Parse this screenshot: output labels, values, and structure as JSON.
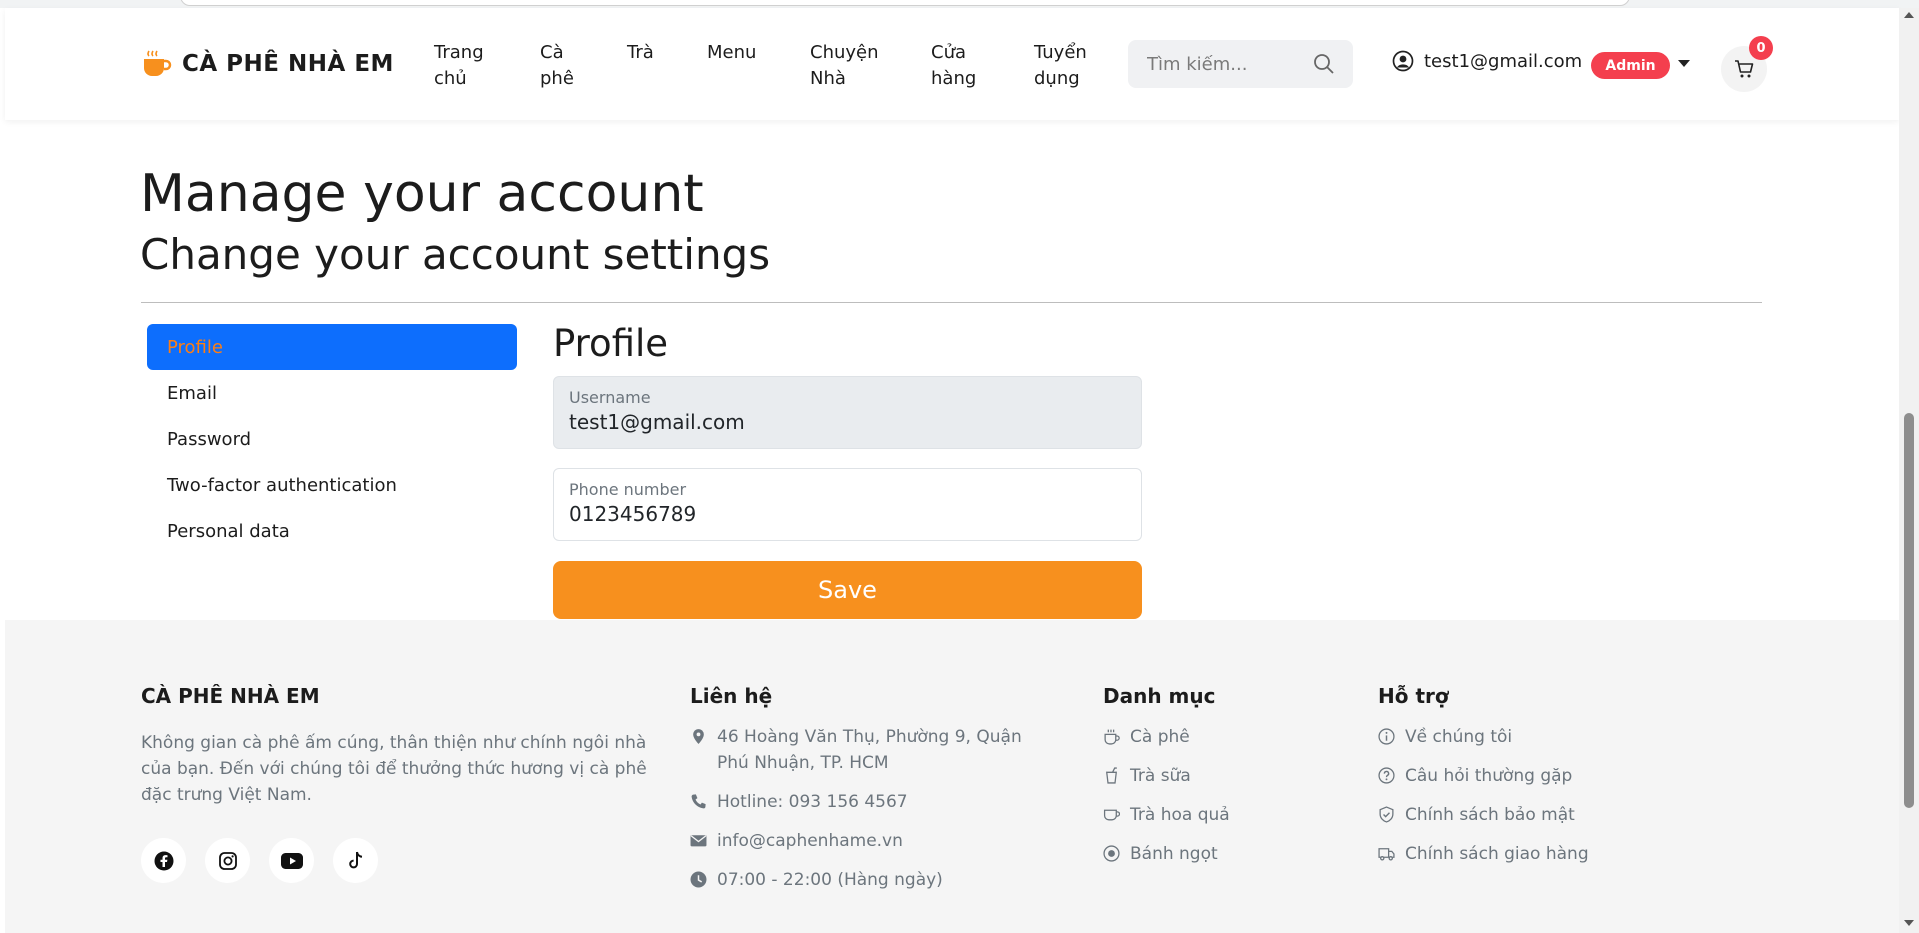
{
  "header": {
    "brand_name": "CÀ PHÊ NHÀ EM",
    "logo_icon": "coffee-cup-icon",
    "nav": [
      {
        "label": "Trang\nchủ"
      },
      {
        "label": "Cà\nphê"
      },
      {
        "label": "Trà"
      },
      {
        "label": "Menu"
      },
      {
        "label": "Chuyện\nNhà"
      },
      {
        "label": "Cửa\nhàng"
      },
      {
        "label": "Tuyển\ndụng"
      }
    ],
    "search_placeholder": "Tìm kiếm...",
    "user_email": "test1@gmail.com",
    "role_badge": "Admin",
    "cart_count": "0"
  },
  "page": {
    "title": "Manage your account",
    "subtitle": "Change your account settings"
  },
  "sidebar": {
    "items": [
      {
        "label": "Profile",
        "active": true
      },
      {
        "label": "Email"
      },
      {
        "label": "Password"
      },
      {
        "label": "Two-factor authentication"
      },
      {
        "label": "Personal data"
      }
    ]
  },
  "profile": {
    "title": "Profile",
    "username_label": "Username",
    "username_value": "test1@gmail.com",
    "phone_label": "Phone number",
    "phone_value": "0123456789",
    "save_label": "Save"
  },
  "footer": {
    "about": {
      "title": "CÀ PHÊ NHÀ EM",
      "description": "Không gian cà phê ấm cúng, thân thiện như chính ngôi nhà của bạn. Đến với chúng tôi để thưởng thức hương vị cà phê đặc trưng Việt Nam.",
      "social": [
        "facebook-icon",
        "instagram-icon",
        "youtube-icon",
        "tiktok-icon"
      ]
    },
    "contact": {
      "title": "Liên hệ",
      "items": [
        {
          "icon": "map-pin-icon",
          "text": "46 Hoàng Văn Thụ, Phường 9, Quận Phú Nhuận, TP. HCM"
        },
        {
          "icon": "phone-icon",
          "text": "Hotline: 093 156 4567"
        },
        {
          "icon": "envelope-icon",
          "text": "info@caphenhame.vn"
        },
        {
          "icon": "clock-icon",
          "text": "07:00 - 22:00 (Hàng ngày)"
        }
      ]
    },
    "categories": {
      "title": "Danh mục",
      "items": [
        {
          "icon": "coffee-cup-icon",
          "text": "Cà phê"
        },
        {
          "icon": "cup-straw-icon",
          "text": "Trà sữa"
        },
        {
          "icon": "teacup-icon",
          "text": "Trà hoa quả"
        },
        {
          "icon": "cake-icon",
          "text": "Bánh ngọt"
        }
      ]
    },
    "support": {
      "title": "Hỗ trợ",
      "items": [
        {
          "icon": "info-icon",
          "text": "Về chúng tôi"
        },
        {
          "icon": "question-icon",
          "text": "Câu hỏi thường gặp"
        },
        {
          "icon": "shield-icon",
          "text": "Chính sách bảo mật"
        },
        {
          "icon": "truck-icon",
          "text": "Chính sách giao hàng"
        }
      ]
    }
  },
  "colors": {
    "accent_orange": "#f7901e",
    "active_blue": "#0d6efd",
    "badge_red": "#f43f4e"
  }
}
